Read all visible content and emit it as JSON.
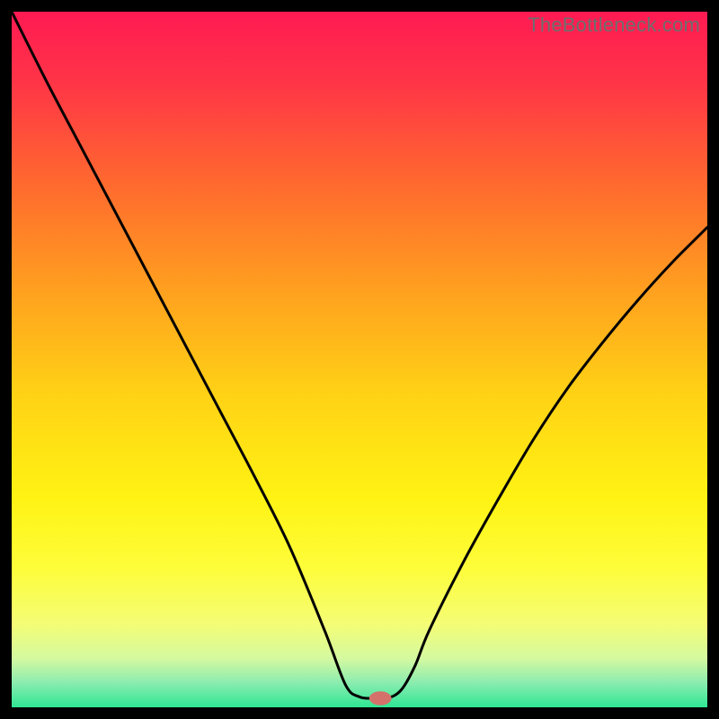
{
  "watermark": "TheBottleneck.com",
  "chart_data": {
    "type": "line",
    "title": "",
    "xlabel": "",
    "ylabel": "",
    "xlim": [
      0,
      100
    ],
    "ylim": [
      0,
      100
    ],
    "grid": false,
    "legend": false,
    "series": [
      {
        "name": "curve",
        "x": [
          0,
          5,
          10,
          15,
          20,
          25,
          30,
          35,
          40,
          45,
          48,
          50,
          52,
          54,
          56,
          58,
          60,
          65,
          70,
          75,
          80,
          85,
          90,
          95,
          100
        ],
        "y": [
          100,
          90,
          80.5,
          71,
          61.5,
          52,
          42.5,
          33,
          23,
          11,
          3.2,
          1.5,
          1.3,
          1.3,
          2.5,
          6,
          11,
          21,
          30,
          38.5,
          46,
          52.5,
          58.5,
          64,
          69
        ]
      }
    ],
    "marker": {
      "x": 53,
      "y": 1.3,
      "rx": 1.6,
      "ry": 1.0,
      "color": "#d4716b"
    },
    "gradient_stops": [
      {
        "offset": 0.0,
        "color": "#ff1a53"
      },
      {
        "offset": 0.1,
        "color": "#ff3447"
      },
      {
        "offset": 0.25,
        "color": "#ff6a2e"
      },
      {
        "offset": 0.4,
        "color": "#ffa01f"
      },
      {
        "offset": 0.55,
        "color": "#ffd215"
      },
      {
        "offset": 0.7,
        "color": "#fff314"
      },
      {
        "offset": 0.8,
        "color": "#fdfd3a"
      },
      {
        "offset": 0.88,
        "color": "#f4fd75"
      },
      {
        "offset": 0.93,
        "color": "#d4f9a0"
      },
      {
        "offset": 0.965,
        "color": "#8aecb0"
      },
      {
        "offset": 1.0,
        "color": "#2fe693"
      }
    ]
  }
}
